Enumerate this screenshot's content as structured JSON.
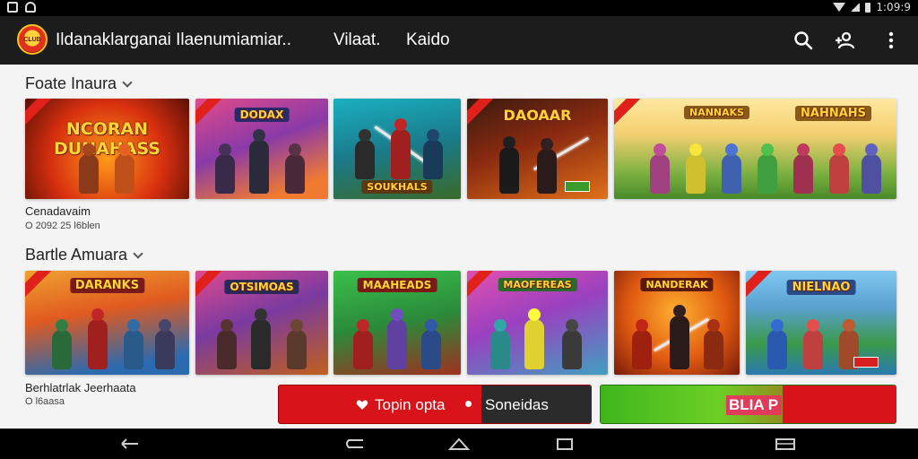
{
  "status": {
    "time": "1:09:9"
  },
  "appbar": {
    "title": "Ildanaklarganai Ilaenumiamiar..",
    "tabs": [
      "Vilaat.",
      "Kaido"
    ],
    "logo_text": "CLUB",
    "icons": [
      "search-icon",
      "add-user-icon",
      "more-vert-icon"
    ]
  },
  "sections": [
    {
      "title": "Foate Inaura",
      "meta_title": "Cenadavaim",
      "meta_sub": "O 2092 25 l6blen",
      "tiles": [
        {
          "banner": "NCORAN DUNAHASS"
        },
        {
          "banner": "DODAX"
        },
        {
          "banner": "SOUKHALS"
        },
        {
          "banner": "DAOAAR"
        },
        {
          "banner": "NANNAKS"
        },
        {
          "banner": "NAHNAHS"
        }
      ]
    },
    {
      "title": "Bartle Amuara",
      "meta_title": "Berhlatrlak Jeerhaata",
      "meta_sub": "O l6aasa",
      "tiles": [
        {
          "banner": "DARANKS"
        },
        {
          "banner": "OTSIMOAS"
        },
        {
          "banner": "MAAHEADS"
        },
        {
          "banner": "MAOFEREAS"
        },
        {
          "banner": "NANDERAK"
        },
        {
          "banner": "NIELNAO"
        }
      ]
    }
  ],
  "actions": {
    "primary_label": "Topin opta",
    "secondary_label": "Soneidas",
    "green_label": "BLIA P"
  },
  "colors": {
    "accent_red": "#d8141a",
    "accent_green": "#3fb61c",
    "appbar": "#1c1c1c"
  }
}
